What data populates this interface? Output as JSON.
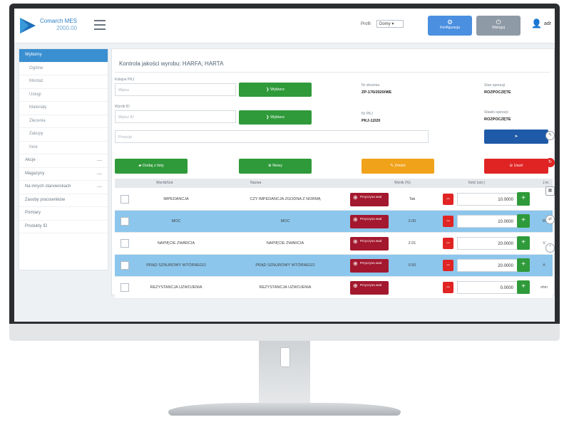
{
  "app": {
    "logo_title": "Comarch MES",
    "logo_subtitle": "2000.00",
    "profile_label": "Profil",
    "profile_value": "Domy",
    "config_button": "Konfiguracja",
    "logout_button": "Wyloguj",
    "user_name": "adr"
  },
  "sidebar": {
    "items": [
      {
        "label": "Wyborny",
        "active": true
      },
      {
        "label": "Ogólne"
      },
      {
        "label": "Montaż"
      },
      {
        "label": "Usługi"
      },
      {
        "label": "Materiały"
      },
      {
        "label": "Zlecenia"
      },
      {
        "label": "Zakupy"
      },
      {
        "label": "Inne"
      },
      {
        "label": "Akcje"
      },
      {
        "label": "Magazyny"
      },
      {
        "label": "Na innych stanowiskach"
      },
      {
        "label": "Zasoby pracowników"
      },
      {
        "label": "Pomiary"
      },
      {
        "label": "Produkty ID"
      }
    ]
  },
  "panel": {
    "title": "Kontrola jakości wyrobu: HARFA; HARTA",
    "field1_label": "Kolejne PKJ",
    "field1_placeholder": "Wpisz",
    "field2_label": "Wyrób ID",
    "field2_placeholder": "Wpisz ID",
    "field3_placeholder": "Pozycje",
    "select_button": "Wybierz",
    "info": {
      "label1": "Nr zlecenia",
      "value1": "ZP-176/2020/WE",
      "label2": "Nr PKJ",
      "value2": "PKJ-12/20",
      "label3": "Stan operacji",
      "value3": "ROZPOCZĘTE",
      "label4": "Stawki operacji",
      "value4": "ROZPOCZĘTE"
    },
    "actions": {
      "add_button": "Dodaj z listy",
      "new_button": "Nowy",
      "edit_button": "Zmień",
      "delete_button": "Usuń"
    }
  },
  "table": {
    "headers": [
      "Wyrób/Usł.",
      "Nazwa",
      "Wynik (%)",
      "Ilość (szt.)",
      "J.m."
    ],
    "defect_button": "Przyczyna wad",
    "rows": [
      {
        "code": "IMPEDANCJA",
        "name": "CZY IMPEDANCJA ZGODNA Z NORMĄ",
        "result": "Tak",
        "qty": "10.0000",
        "unit": "",
        "selected": false
      },
      {
        "code": "MOC",
        "name": "MOC",
        "result": "2.00",
        "qty": "10.0000",
        "unit": "W",
        "selected": true
      },
      {
        "code": "NAPIĘCIE ZWARCIA",
        "name": "NAPIĘCIE ZWARCIA",
        "result": "2.01",
        "qty": "20.0000",
        "unit": "V",
        "selected": false
      },
      {
        "code": "PRĄD SZNUROWY WTÓRNEGO",
        "name": "PRĄD SZNUROWY WTÓRNEGO",
        "result": "0.50",
        "qty": "20.0000",
        "unit": "A",
        "selected": true
      },
      {
        "code": "REZYSTANCJA UZWOJENIA",
        "name": "REZYSTANCJA UZWOJENIA",
        "result": "",
        "qty": "0.0000",
        "unit": "ohm",
        "selected": false
      }
    ]
  },
  "colors": {
    "accent_blue": "#3a8fd0",
    "green": "#2f9a3a",
    "orange": "#f0a21a",
    "red": "#e02424",
    "maroon": "#a3182e",
    "navy": "#1f5aa8",
    "row_selected": "#8cc6ec"
  },
  "icons": {
    "config": "gear-icon",
    "logout": "power-icon",
    "user": "user-icon",
    "select": "chevron-right-icon",
    "add": "folder-icon",
    "new": "plus-circle-icon",
    "edit": "pencil-icon",
    "delete": "minus-circle-icon",
    "defect": "plus-circle-icon"
  }
}
